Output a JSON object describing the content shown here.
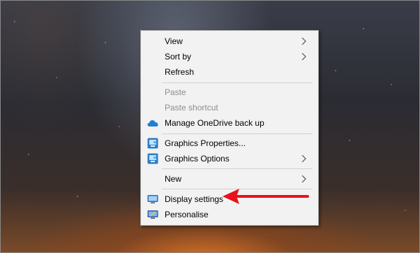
{
  "desktop": {
    "context_menu": {
      "items": [
        {
          "label": "View",
          "submenu": true,
          "enabled": true
        },
        {
          "label": "Sort by",
          "submenu": true,
          "enabled": true
        },
        {
          "label": "Refresh",
          "submenu": false,
          "enabled": true
        },
        {
          "label": "Paste",
          "submenu": false,
          "enabled": false
        },
        {
          "label": "Paste shortcut",
          "submenu": false,
          "enabled": false
        },
        {
          "label": "Manage OneDrive back up",
          "submenu": false,
          "enabled": true,
          "icon": "onedrive-cloud-icon"
        },
        {
          "label": "Graphics Properties...",
          "submenu": false,
          "enabled": true,
          "icon": "intel-graphics-icon"
        },
        {
          "label": "Graphics Options",
          "submenu": true,
          "enabled": true,
          "icon": "intel-graphics-icon"
        },
        {
          "label": "New",
          "submenu": true,
          "enabled": true
        },
        {
          "label": "Display settings",
          "submenu": false,
          "enabled": true,
          "icon": "display-monitor-icon"
        },
        {
          "label": "Personalise",
          "submenu": false,
          "enabled": true,
          "icon": "personalise-icon"
        }
      ]
    },
    "annotation": {
      "icon": "red-arrow-icon",
      "color": "#e8121b",
      "points_to": "Display settings"
    }
  }
}
